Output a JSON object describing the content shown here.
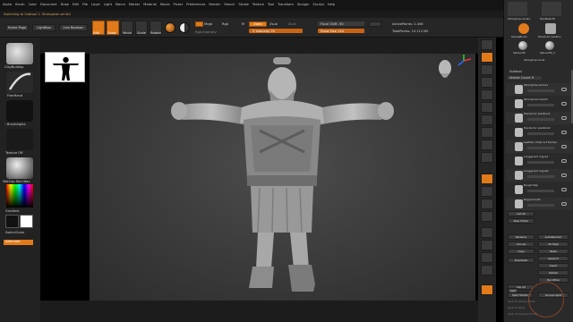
{
  "menu": [
    "Alpha",
    "Brush",
    "Color",
    "Document",
    "Draw",
    "Edit",
    "File",
    "Layer",
    "Light",
    "Macro",
    "Marker",
    "Material",
    "Movie",
    "Picker",
    "Preferences",
    "Render",
    "Stencil",
    "Stroke",
    "Texture",
    "Tool",
    "Transform",
    "Zplugin",
    "Zscript",
    "Help"
  ],
  "status": {
    "switch_text": "Switching to Subtool 1: Strongman.arnle1"
  },
  "toolbar": {
    "buttons": [
      "Home Page",
      "LightBox",
      "Live Boolean"
    ],
    "edit": "Edit",
    "draw": "Draw",
    "move": "Move",
    "scale": "Scale",
    "rotate": "Rotate",
    "mrgb": "Mrgb",
    "rgb": "Rgb",
    "m": "M",
    "zadd": "Zadd",
    "zsub": "Zsub",
    "zcut": "Zcut",
    "z_intensity": "Z Intensity 20",
    "focal_shift": "Focal Shift -90",
    "draw_size": "Draw Size 124",
    "active_points": "ActivePoints: 2.456",
    "total_points": "TotalPoints: 10.112 Mil",
    "rgb_intensity": "Rgb Intensity"
  },
  "left": {
    "brush": "ClayBuildup",
    "stroke": "FreeHand",
    "alpha": "~BrushAlpha",
    "texture": "Texture Off",
    "material": "MatCap Red Wax",
    "gradient": "Gradient",
    "switch_color": "SwitchColor",
    "alternate": "Alternate"
  },
  "colors": {
    "accent": "#e07a1a",
    "canvas": "#3d3d3d"
  },
  "subtool": {
    "header": "Subtool",
    "visible_count": "Visible Count 9",
    "items": [
      "Strongman.arnle1",
      "Strongman.head1",
      "Hands-fur position1",
      "Hands-fur position2",
      "Leather chest w Thomas",
      "Longguard rogue1",
      "Longguard rogue2",
      "Rough flap",
      "Rogue boots"
    ]
  },
  "palette_buttons": [
    "List All",
    "New Folder",
    "Rename",
    "AutoReorder",
    "All Low",
    "All High",
    "Copy",
    "Paste",
    "Duplicate",
    "Append",
    "Insert",
    "Delete",
    "Del Other",
    "Del All",
    "Split",
    "Split Hidden",
    "Groups Split",
    "Split To Similar Parts",
    "Split To Parts",
    "Split Unmasked Points"
  ],
  "tool_thumbs": [
    "Strongman.arnle1",
    "PolyMesh3D",
    "SimpleBrush",
    "Hands-fur position",
    "Sphere3D",
    "Sphere3D_1",
    "Strongman.arnle"
  ]
}
